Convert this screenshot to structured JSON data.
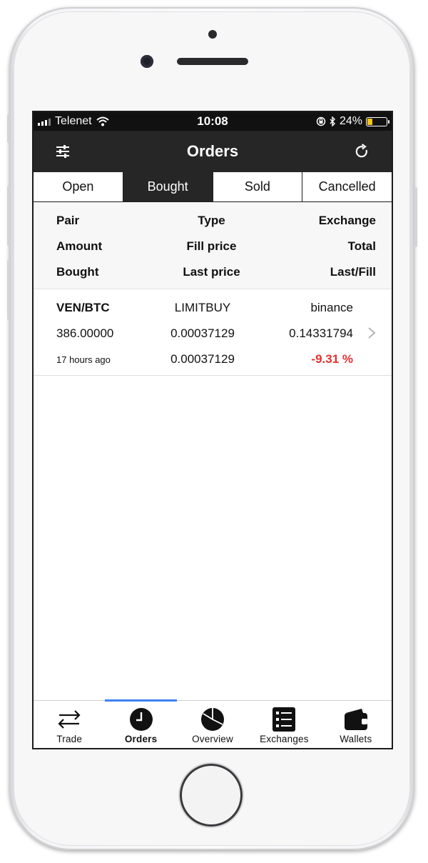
{
  "statusbar": {
    "carrier": "Telenet",
    "time": "10:08",
    "battery_text": "24%",
    "battery_level": 0.24,
    "battery_color": "#f5c518"
  },
  "navbar": {
    "title": "Orders",
    "left_icon": "filter-sliders-icon",
    "right_icon": "refresh-icon"
  },
  "segments": [
    {
      "label": "Open",
      "active": false
    },
    {
      "label": "Bought",
      "active": true
    },
    {
      "label": "Sold",
      "active": false
    },
    {
      "label": "Cancelled",
      "active": false
    }
  ],
  "headers": {
    "row1": [
      "Pair",
      "Type",
      "Exchange"
    ],
    "row2": [
      "Amount",
      "Fill price",
      "Total"
    ],
    "row3": [
      "Bought",
      "Last price",
      "Last/Fill"
    ]
  },
  "orders": [
    {
      "pair": "VEN/BTC",
      "type": "LIMITBUY",
      "exchange": "binance",
      "amount": "386.00000",
      "fill_price": "0.00037129",
      "total": "0.14331794",
      "time_ago": "17 hours ago",
      "last_price": "0.00037129",
      "change": "-9.31 %",
      "change_color": "#e53030"
    }
  ],
  "tabs": [
    {
      "label": "Trade",
      "icon": "swap-arrows-icon",
      "active": false
    },
    {
      "label": "Orders",
      "icon": "clock-icon",
      "active": true
    },
    {
      "label": "Overview",
      "icon": "pie-chart-icon",
      "active": false
    },
    {
      "label": "Exchanges",
      "icon": "list-icon",
      "active": false
    },
    {
      "label": "Wallets",
      "icon": "wallet-icon",
      "active": false
    }
  ],
  "accent_color": "#3d82f6"
}
